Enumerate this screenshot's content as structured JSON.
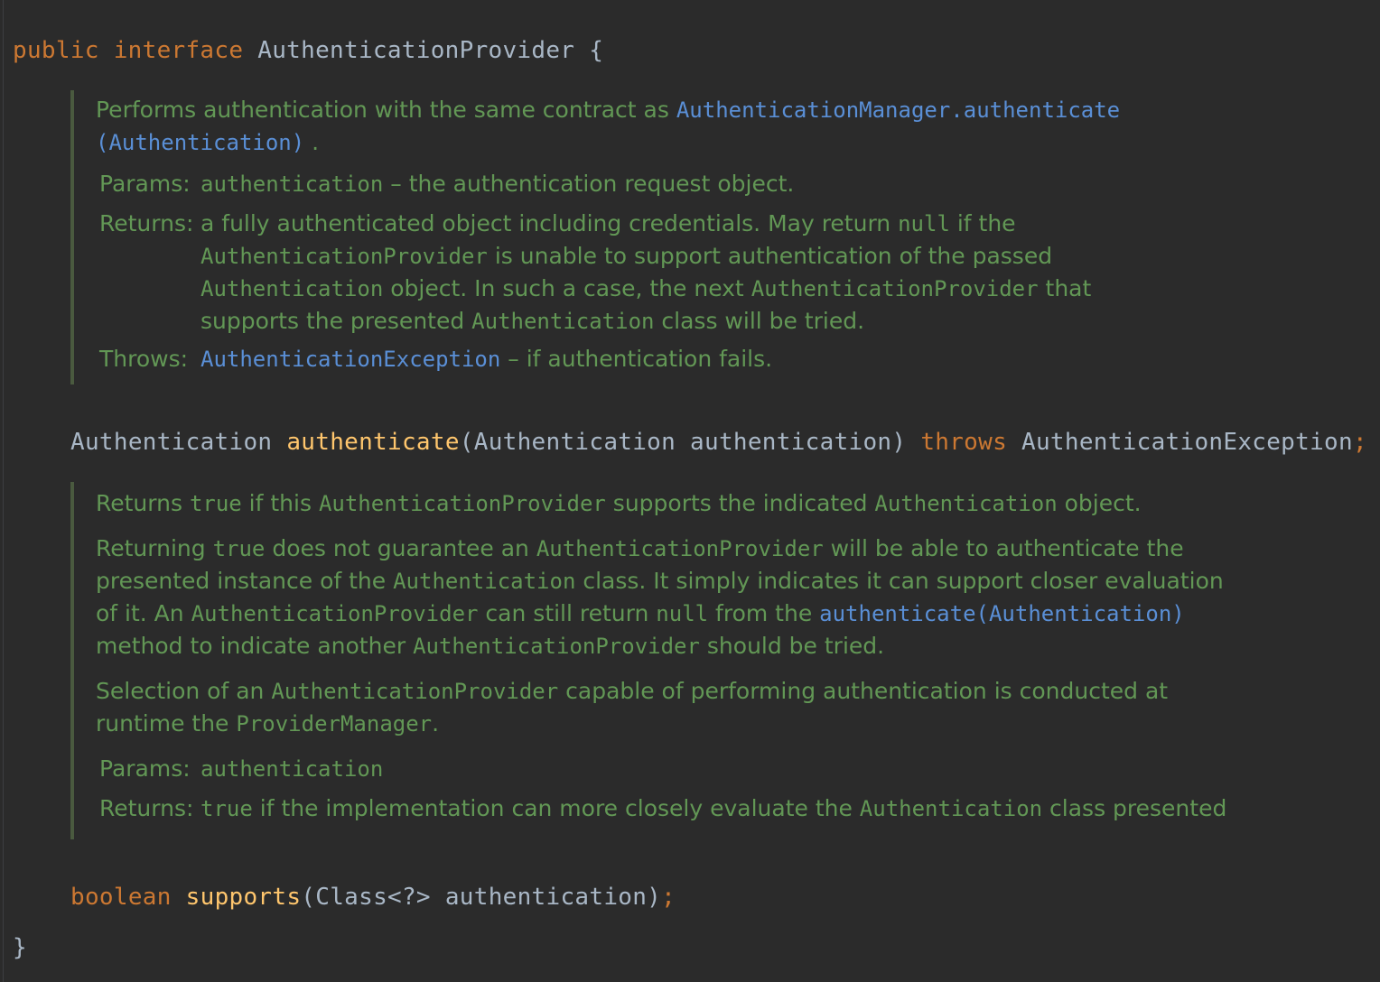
{
  "code": {
    "line1": {
      "kw1": "public",
      "kw2": "interface",
      "name": "AuthenticationProvider",
      "brace": "{"
    },
    "method1": {
      "ret": "Authentication",
      "name": "authenticate",
      "params": "(Authentication authentication)",
      "kw_throws": "throws",
      "exception": "AuthenticationException",
      "semi": ";"
    },
    "method2": {
      "ret": "boolean",
      "name": "supports",
      "params": "(Class<?> authentication)",
      "semi": ";"
    },
    "close_brace": "}"
  },
  "doc1": {
    "summary_text": "Performs authentication with the same contract as ",
    "summary_link": "AuthenticationManager.authenticate (Authentication)",
    "summary_end": " .",
    "params_label": "Params:",
    "params_name": "authentication",
    "params_desc": " – the authentication request object.",
    "returns_label": "Returns:",
    "returns_1": "a fully authenticated object including credentials. May return ",
    "returns_null": "null",
    "returns_2": " if the",
    "returns_provider": "AuthenticationProvider",
    "returns_3": " is unable to support authentication of the passed",
    "returns_auth": "Authentication",
    "returns_4": " object. In such a case, the next ",
    "returns_provider2": "AuthenticationProvider",
    "returns_5": " that",
    "returns_6": "supports the presented ",
    "returns_auth2": "Authentication",
    "returns_7": " class will be tried.",
    "throws_label": "Throws:",
    "throws_link": "AuthenticationException",
    "throws_desc": " – if authentication fails."
  },
  "doc2": {
    "p1_a": "Returns ",
    "p1_true": "true",
    "p1_b": " if this ",
    "p1_provider": "AuthenticationProvider",
    "p1_c": " supports the indicated ",
    "p1_auth": "Authentication",
    "p1_d": " object.",
    "p2_a": "Returning ",
    "p2_true": "true",
    "p2_b": " does not guarantee an ",
    "p2_provider": "AuthenticationProvider",
    "p2_c": " will be able to authenticate the",
    "p2_d": "presented instance of the ",
    "p2_auth": "Authentication",
    "p2_e": " class. It simply indicates it can support closer evaluation",
    "p2_f": "of it. An ",
    "p2_provider2": "AuthenticationProvider",
    "p2_g": " can still return ",
    "p2_null": "null",
    "p2_h": " from the ",
    "p2_link": "authenticate(Authentication)",
    "p2_i": "method to indicate another ",
    "p2_provider3": "AuthenticationProvider",
    "p2_j": " should be tried.",
    "p3_a": "Selection of an ",
    "p3_provider": "AuthenticationProvider",
    "p3_b": " capable of performing authentication is conducted at",
    "p3_c": "runtime the ",
    "p3_manager": "ProviderManager",
    "p3_d": ".",
    "params_label": "Params:",
    "params_name": "authentication",
    "returns_label": "Returns:",
    "returns_true": "true",
    "returns_a": " if the implementation can more closely evaluate the ",
    "returns_auth": "Authentication",
    "returns_b": " class presented"
  },
  "colors": {
    "background": "#2b2b2b",
    "keyword": "#cc7832",
    "method": "#ffc66d",
    "text": "#a9b7c6",
    "doc_text": "#629755",
    "doc_link": "#5a8fd6"
  }
}
